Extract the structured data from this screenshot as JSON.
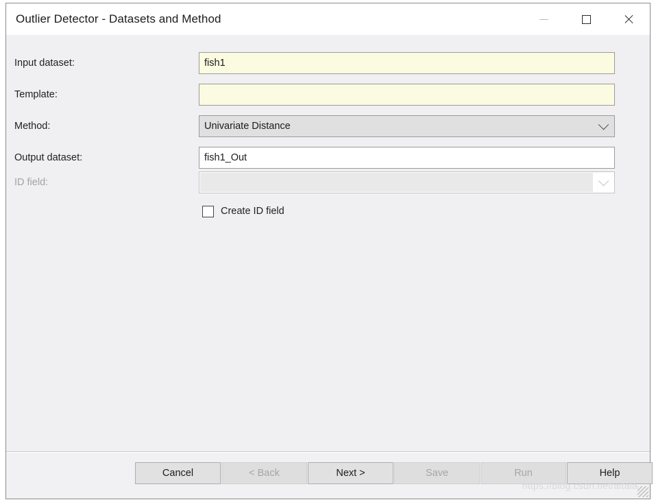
{
  "window": {
    "title": "Outlier Detector - Datasets and Method",
    "controls": {
      "minimize_label": "Minimize",
      "maximize_label": "Maximize",
      "close_label": "Close"
    }
  },
  "form": {
    "rows": [
      {
        "label": "Input dataset:",
        "type": "text",
        "value": "fish1",
        "placeholder": "",
        "disabled": false,
        "style": "yellow"
      },
      {
        "label": "Template:",
        "type": "text",
        "value": "",
        "placeholder": "",
        "disabled": false,
        "style": "yellow"
      },
      {
        "label": "Method:",
        "type": "combo",
        "value": "Univariate Distance",
        "disabled": false
      },
      {
        "label": "Output dataset:",
        "type": "text",
        "value": "fish1_Out",
        "placeholder": "",
        "disabled": false,
        "style": "white"
      },
      {
        "label": "ID field:",
        "type": "combo",
        "value": "",
        "disabled": true
      }
    ],
    "checkbox": {
      "label": "Create ID field",
      "checked": false
    }
  },
  "footer": {
    "buttons": [
      {
        "label": "Cancel",
        "disabled": false
      },
      {
        "label": "< Back",
        "disabled": true
      },
      {
        "label": "Next >",
        "disabled": false
      },
      {
        "label": "Save",
        "disabled": true
      },
      {
        "label": "Run",
        "disabled": true
      },
      {
        "label": "Help",
        "disabled": false
      }
    ],
    "watermark": "https://blog.csdn.net/aitala"
  },
  "colors": {
    "dialog_background": "#f0eff1",
    "titlebar_background": "#ffffff",
    "field_yellow": "#fbfbe1",
    "field_white": "#ffffff",
    "button_face": "#e1e1e1",
    "disabled_text": "#a6a6a6"
  }
}
